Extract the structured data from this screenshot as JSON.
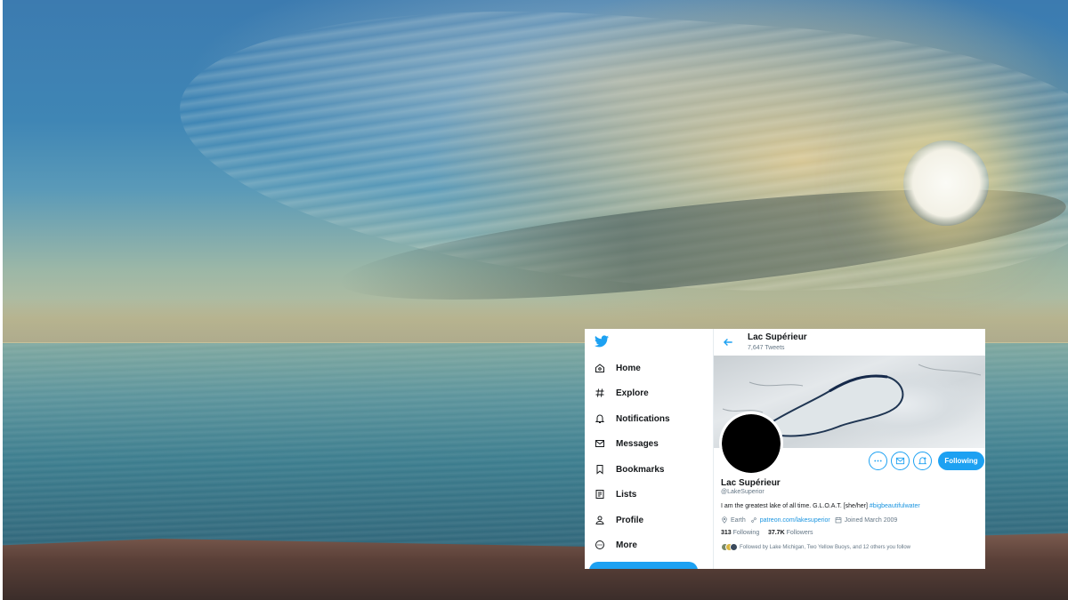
{
  "colors": {
    "twitter_blue": "#1da1f2",
    "link_blue": "#1b95e0",
    "text_primary": "#14171a",
    "text_secondary": "#657786"
  },
  "icons": {
    "logo": "twitter-bird-icon",
    "back": "arrow-left-icon"
  },
  "sidebar": {
    "items": [
      {
        "label": "Home",
        "icon": "home-icon"
      },
      {
        "label": "Explore",
        "icon": "hashtag-icon"
      },
      {
        "label": "Notifications",
        "icon": "bell-icon"
      },
      {
        "label": "Messages",
        "icon": "envelope-icon"
      },
      {
        "label": "Bookmarks",
        "icon": "bookmark-icon"
      },
      {
        "label": "Lists",
        "icon": "list-icon"
      },
      {
        "label": "Profile",
        "icon": "person-icon"
      },
      {
        "label": "More",
        "icon": "more-circle-icon"
      }
    ]
  },
  "header": {
    "name": "Lac Supérieur",
    "tweet_count": "7,647 Tweets"
  },
  "profile": {
    "name": "Lac Supérieur",
    "handle": "@LakeSuperior",
    "bio_text": "I am the greatest lake of all time. G.L.O.A.T. [she/her] ",
    "bio_hashtag": "#bigbeautifulwater",
    "location": "Earth",
    "website": "patreon.com/lakesuperior",
    "joined": "Joined March 2009",
    "following_count": "313",
    "following_label": "Following",
    "followers_count": "37.7K",
    "followers_label": "Followers",
    "followed_by": "Followed by Lake Michigan, Two Yellow Buoys, and 12 others you follow",
    "follow_button_label": "Following"
  }
}
